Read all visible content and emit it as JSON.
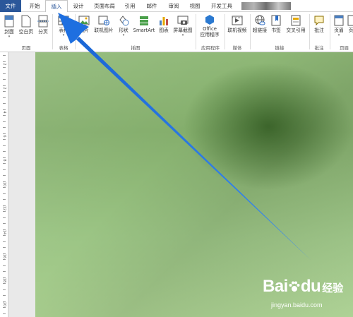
{
  "tabs": [
    {
      "label": "文件"
    },
    {
      "label": "开始"
    },
    {
      "label": "插入"
    },
    {
      "label": "设计"
    },
    {
      "label": "页面布局"
    },
    {
      "label": "引用"
    },
    {
      "label": "邮件"
    },
    {
      "label": "审阅"
    },
    {
      "label": "视图"
    },
    {
      "label": "开发工具"
    }
  ],
  "ribbon": {
    "buttons": [
      {
        "label": "封面",
        "dropdown": "▾",
        "icon": "cover-page-icon"
      },
      {
        "label": "空白页",
        "icon": "blank-page-icon"
      },
      {
        "label": "分页",
        "icon": "page-break-icon"
      },
      {
        "label": "表格",
        "dropdown": "▾",
        "icon": "table-icon"
      },
      {
        "label": "图片",
        "icon": "picture-icon"
      },
      {
        "label": "联机图片",
        "icon": "online-picture-icon"
      },
      {
        "label": "形状",
        "dropdown": "▾",
        "icon": "shapes-icon"
      },
      {
        "label": "SmartArt",
        "icon": "smartart-icon"
      },
      {
        "label": "图表",
        "icon": "chart-icon"
      },
      {
        "label": "屏幕截图",
        "dropdown": "▾",
        "icon": "screenshot-icon"
      },
      {
        "label": "Office",
        "label2": "应用程序",
        "dropdown": "▾",
        "icon": "office-apps-icon"
      },
      {
        "label": "联机视频",
        "icon": "online-video-icon"
      },
      {
        "label": "超链接",
        "icon": "hyperlink-icon"
      },
      {
        "label": "书签",
        "icon": "bookmark-icon"
      },
      {
        "label": "交叉引用",
        "icon": "cross-reference-icon"
      },
      {
        "label": "批注",
        "icon": "comment-icon"
      },
      {
        "label": "页眉",
        "dropdown": "▾",
        "icon": "header-icon"
      },
      {
        "label": "页",
        "icon": "footer-icon"
      }
    ],
    "groups": [
      {
        "label": "页面"
      },
      {
        "label": "表格"
      },
      {
        "label": "插图"
      },
      {
        "label": "应用程序"
      },
      {
        "label": "媒体"
      },
      {
        "label": "链接"
      },
      {
        "label": "批注"
      },
      {
        "label": "页眉"
      }
    ]
  },
  "ruler_numbers": [
    "2",
    "2",
    "4",
    "6",
    "8",
    "10",
    "12",
    "14",
    "16",
    "18",
    "20"
  ],
  "watermark": {
    "logo": "Bai",
    "logo2": "du",
    "cn": "经验",
    "url": "jingyan.baidu.com"
  },
  "colors": {
    "accent": "#2b579a",
    "arrow": "#1e6fe0",
    "doc_bg": "#8fb877"
  }
}
